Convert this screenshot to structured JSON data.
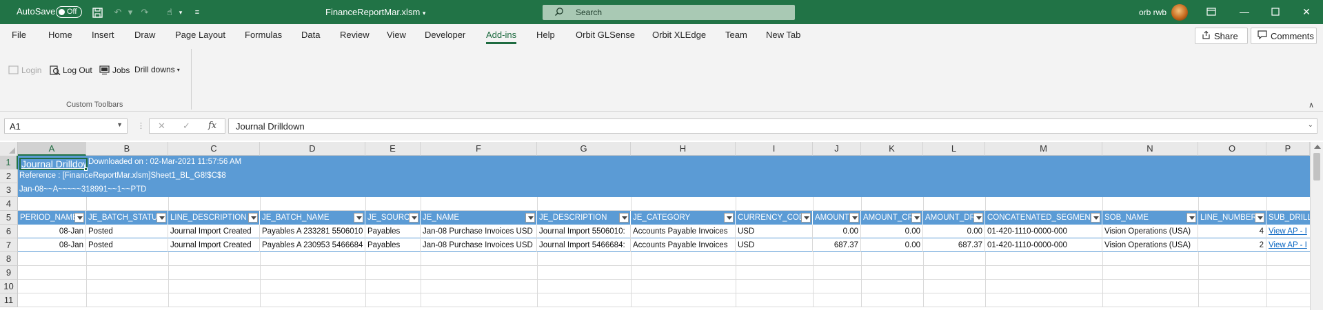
{
  "titlebar": {
    "autosave_label": "AutoSave",
    "autosave_state": "Off",
    "file_name": "FinanceReportMar.xlsm",
    "search_placeholder": "Search",
    "user_name": "orb rwb",
    "accent_color": "#217346"
  },
  "ribbon_tabs": [
    "File",
    "Home",
    "Insert",
    "Draw",
    "Page Layout",
    "Formulas",
    "Data",
    "Review",
    "View",
    "Developer",
    "Add-ins",
    "Help",
    "Orbit GLSense",
    "Orbit XLEdge",
    "Team",
    "New Tab"
  ],
  "active_tab": "Add-ins",
  "share_label": "Share",
  "comments_label": "Comments",
  "toolbar": {
    "login": "Login",
    "logout": "Log Out",
    "jobs": "Jobs",
    "drilldowns": "Drill downs",
    "group_label": "Custom Toolbars"
  },
  "formula_bar": {
    "name_box": "A1",
    "formula": "Journal Drilldown"
  },
  "columns": [
    "A",
    "B",
    "C",
    "D",
    "E",
    "F",
    "G",
    "H",
    "I",
    "J",
    "K",
    "L",
    "M",
    "N",
    "O",
    "P"
  ],
  "rows": [
    "1",
    "2",
    "3",
    "4",
    "5",
    "6",
    "7",
    "8",
    "9",
    "10",
    "11"
  ],
  "sheet": {
    "title": "Journal Drilldown",
    "downloaded": "Downloaded on : 02-Mar-2021 11:57:56 AM",
    "reference": "Reference : [FinanceReportMar.xlsm]Sheet1_BL_G8!$C$8",
    "criteria": "Jan-08~~A~~~~~318991~~1~~PTD",
    "band_color": "#5b9bd5",
    "headers": [
      "PERIOD_NAME",
      "JE_BATCH_STATUS",
      "LINE_DESCRIPTION",
      "JE_BATCH_NAME",
      "JE_SOURCE",
      "JE_NAME",
      "JE_DESCRIPTION",
      "JE_CATEGORY",
      "CURRENCY_CODE",
      "AMOUNT",
      "AMOUNT_CR",
      "AMOUNT_DR",
      "CONCATENATED_SEGMENTS",
      "SOB_NAME",
      "LINE_NUMBER",
      "SUB_DRILL_"
    ],
    "data_rows": [
      [
        "08-Jan",
        "Posted",
        "Journal Import Created",
        "Payables A 233281 5506010",
        "Payables",
        "Jan-08 Purchase Invoices USD",
        "Journal Import 5506010:",
        "Accounts Payable Invoices",
        "USD",
        "0.00",
        "0.00",
        "0.00",
        "01-420-1110-0000-000",
        "Vision Operations (USA)",
        "4",
        "View AP - I"
      ],
      [
        "08-Jan",
        "Posted",
        "Journal Import Created",
        "Payables A 230953 5466684",
        "Payables",
        "Jan-08 Purchase Invoices USD",
        "Journal Import 5466684:",
        "Accounts Payable Invoices",
        "USD",
        "687.37",
        "0.00",
        "687.37",
        "01-420-1110-0000-000",
        "Vision Operations (USA)",
        "2",
        "View AP - I"
      ]
    ]
  }
}
